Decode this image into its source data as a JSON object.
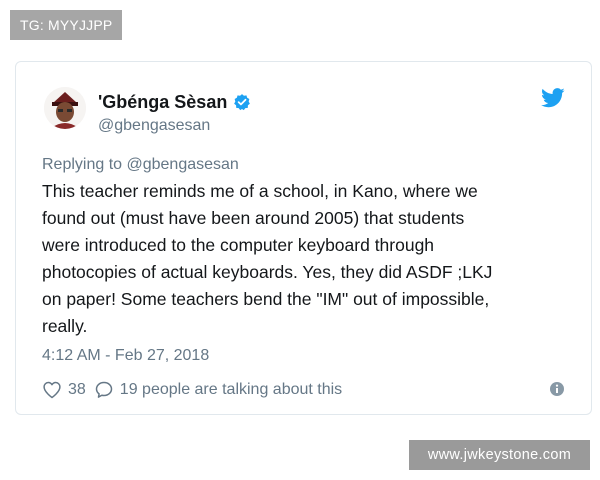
{
  "tag_badge": {
    "text": "TG: MYYJJPP"
  },
  "tweet": {
    "display_name": "'Gbénga Sèsan",
    "handle": "@gbengasesan",
    "replying_to": "Replying to @gbengasesan",
    "text_lines": [
      "This teacher reminds me of a school, in Kano, where we",
      "found out (must have been around 2005) that students",
      "were introduced to the computer keyboard through",
      "photocopies of actual keyboards. Yes, they did ASDF ;LKJ",
      "on paper! Some teachers bend the \"IM\" out of impossible,",
      "really."
    ],
    "timestamp": "4:12 AM - Feb 27, 2018",
    "like_count": "38",
    "reply_text": "19 people are talking about this",
    "colors": {
      "verified": "#1da1f2",
      "twitter_blue": "#1da1f2",
      "secondary_text": "#657786"
    },
    "icons": [
      "avatar",
      "verified-icon",
      "twitter-logo-icon",
      "heart-icon",
      "speech-bubble-icon",
      "info-icon"
    ]
  },
  "watermark": {
    "text": "www.jwkeystone.com"
  }
}
